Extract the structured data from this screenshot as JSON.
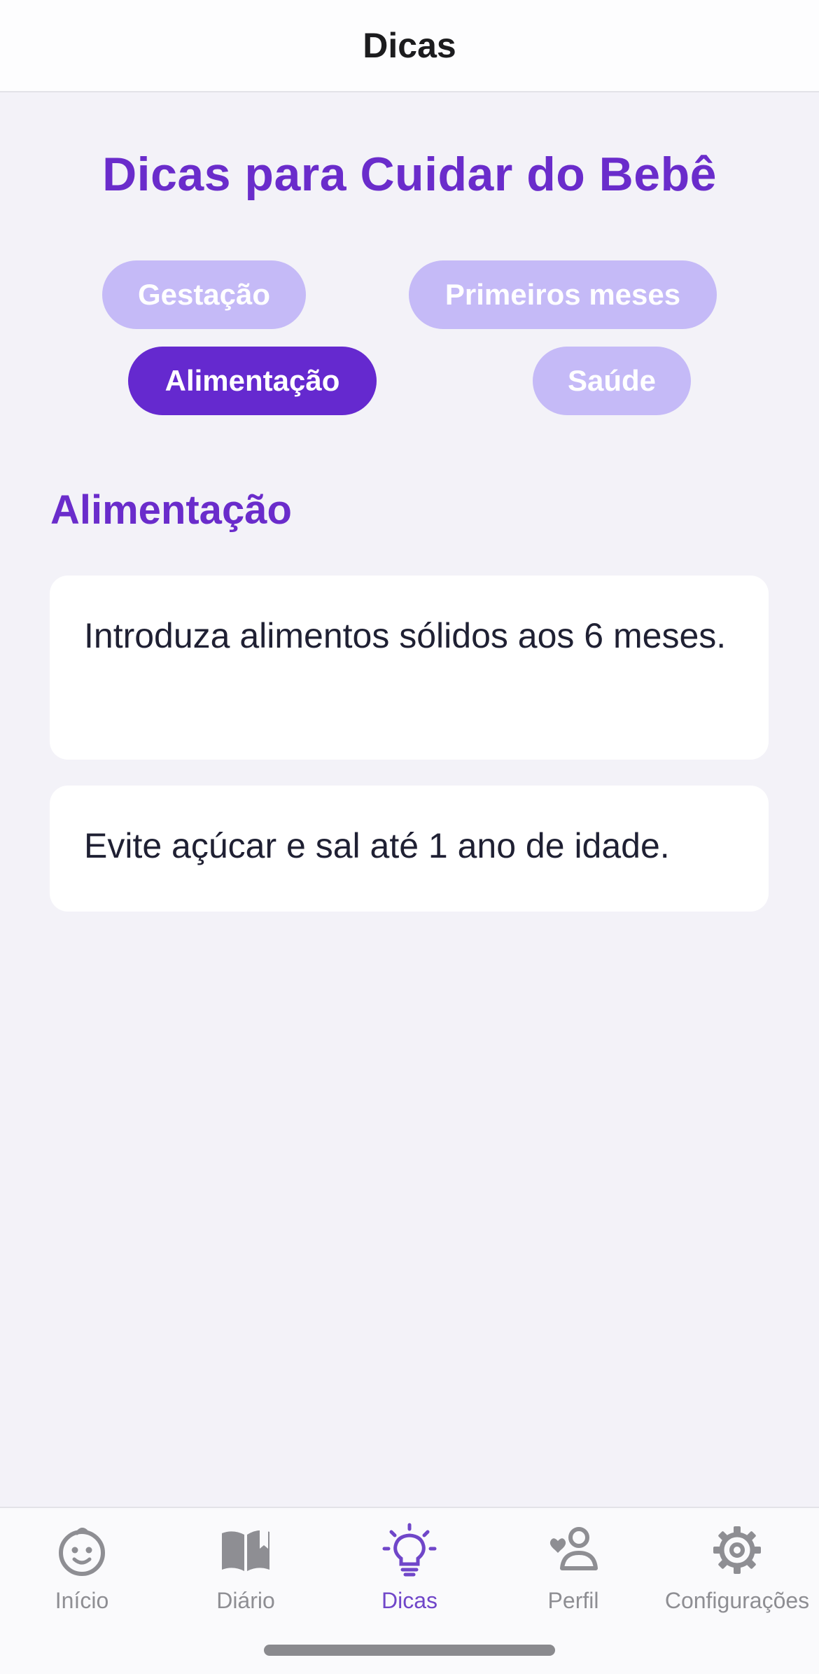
{
  "navbar": {
    "title": "Dicas"
  },
  "page": {
    "title": "Dicas para Cuidar do Bebê"
  },
  "categories": [
    {
      "label": "Gestação",
      "active": false
    },
    {
      "label": "Primeiros meses",
      "active": false
    },
    {
      "label": "Alimentação",
      "active": true
    },
    {
      "label": "Saúde",
      "active": false
    }
  ],
  "section": {
    "title": "Alimentação",
    "tips": [
      "Introduza alimentos sólidos aos 6 meses.",
      "Evite açúcar e sal até 1 ano de idade."
    ]
  },
  "tabbar": {
    "items": [
      {
        "label": "Início",
        "icon": "baby-face-icon",
        "active": false
      },
      {
        "label": "Diário",
        "icon": "book-icon",
        "active": false
      },
      {
        "label": "Dicas",
        "icon": "lightbulb-icon",
        "active": true
      },
      {
        "label": "Perfil",
        "icon": "person-heart-icon",
        "active": false
      },
      {
        "label": "Configurações",
        "icon": "gear-icon",
        "active": false
      }
    ]
  },
  "colors": {
    "accent": "#6a2ccb",
    "chip_inactive": "#c5baf7",
    "chip_active": "#6529cf",
    "tab_active": "#7046c9",
    "tab_inactive": "#8e8e93",
    "background": "#f3f2f8"
  }
}
